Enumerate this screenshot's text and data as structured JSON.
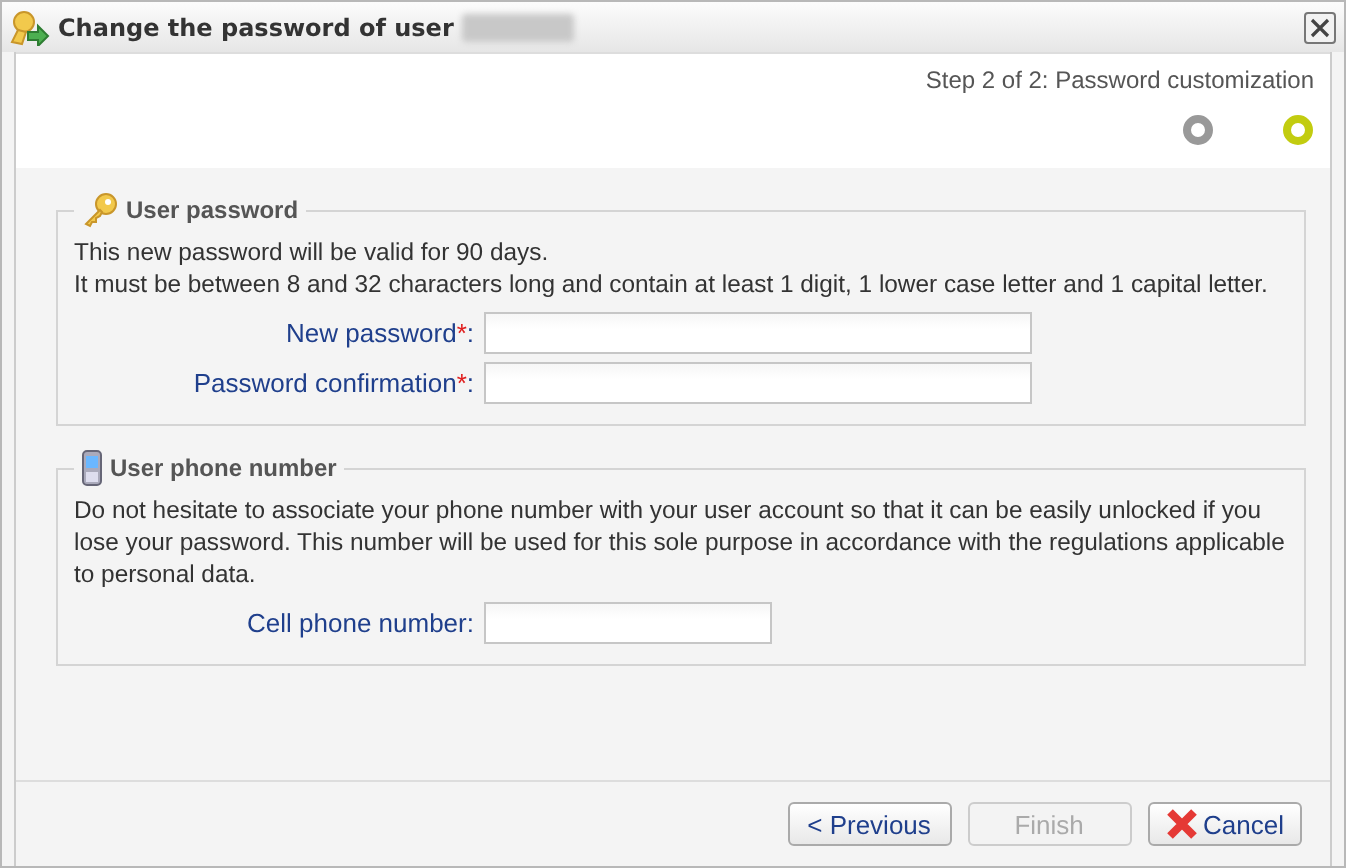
{
  "window": {
    "title": "Change the password of user",
    "title_redacted": true
  },
  "wizard": {
    "step_label": "Step 2 of 2: Password customization",
    "steps": [
      {
        "selected": false
      },
      {
        "selected": true
      }
    ]
  },
  "sections": [
    {
      "title": "User password",
      "kind": "key",
      "paragraphs": [
        "This new password will be valid for 90 days.",
        "It must be between 8 and 32 characters long and contain at least 1 digit, 1 lower case letter and 1 capital letter."
      ],
      "fields": [
        {
          "label": "New password",
          "mark": "*",
          "suffix": ":",
          "kind": "long"
        },
        {
          "label": "Password confirmation",
          "mark": "*",
          "suffix": ":",
          "kind": "long"
        }
      ]
    },
    {
      "title": "User phone number",
      "kind": "phone",
      "paragraphs": [
        "Do not hesitate to associate your phone number with your user account so that it can be easily unlocked if you lose your password. This number will be used for this sole purpose in accordance with the regulations applicable to personal data."
      ],
      "fields": [
        {
          "label": "Cell phone number",
          "suffix": ":",
          "kind": "short"
        }
      ]
    }
  ],
  "buttons": [
    {
      "label": "< Previous",
      "disabled": false,
      "kind": "plain"
    },
    {
      "label": "Finish",
      "disabled": true,
      "kind": "plain"
    },
    {
      "label": "Cancel",
      "disabled": false,
      "kind": "cancel"
    }
  ]
}
